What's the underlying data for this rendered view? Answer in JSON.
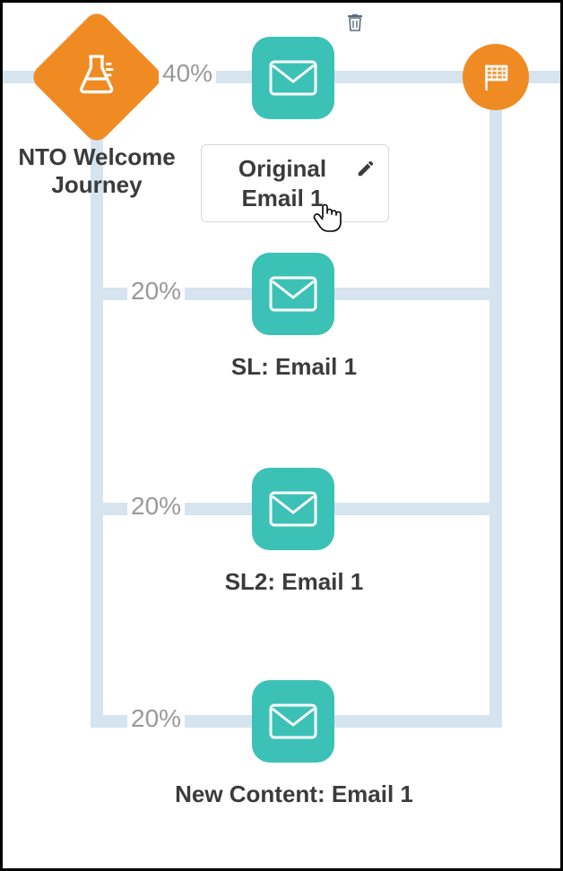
{
  "decision": {
    "label": "NTO Welcome Journey"
  },
  "branches": [
    {
      "percent": "40%",
      "label": "Original Email 1"
    },
    {
      "percent": "20%",
      "label": "SL: Email 1"
    },
    {
      "percent": "20%",
      "label": "SL2: Email 1"
    },
    {
      "percent": "20%",
      "label": "New Content: Email 1"
    }
  ]
}
